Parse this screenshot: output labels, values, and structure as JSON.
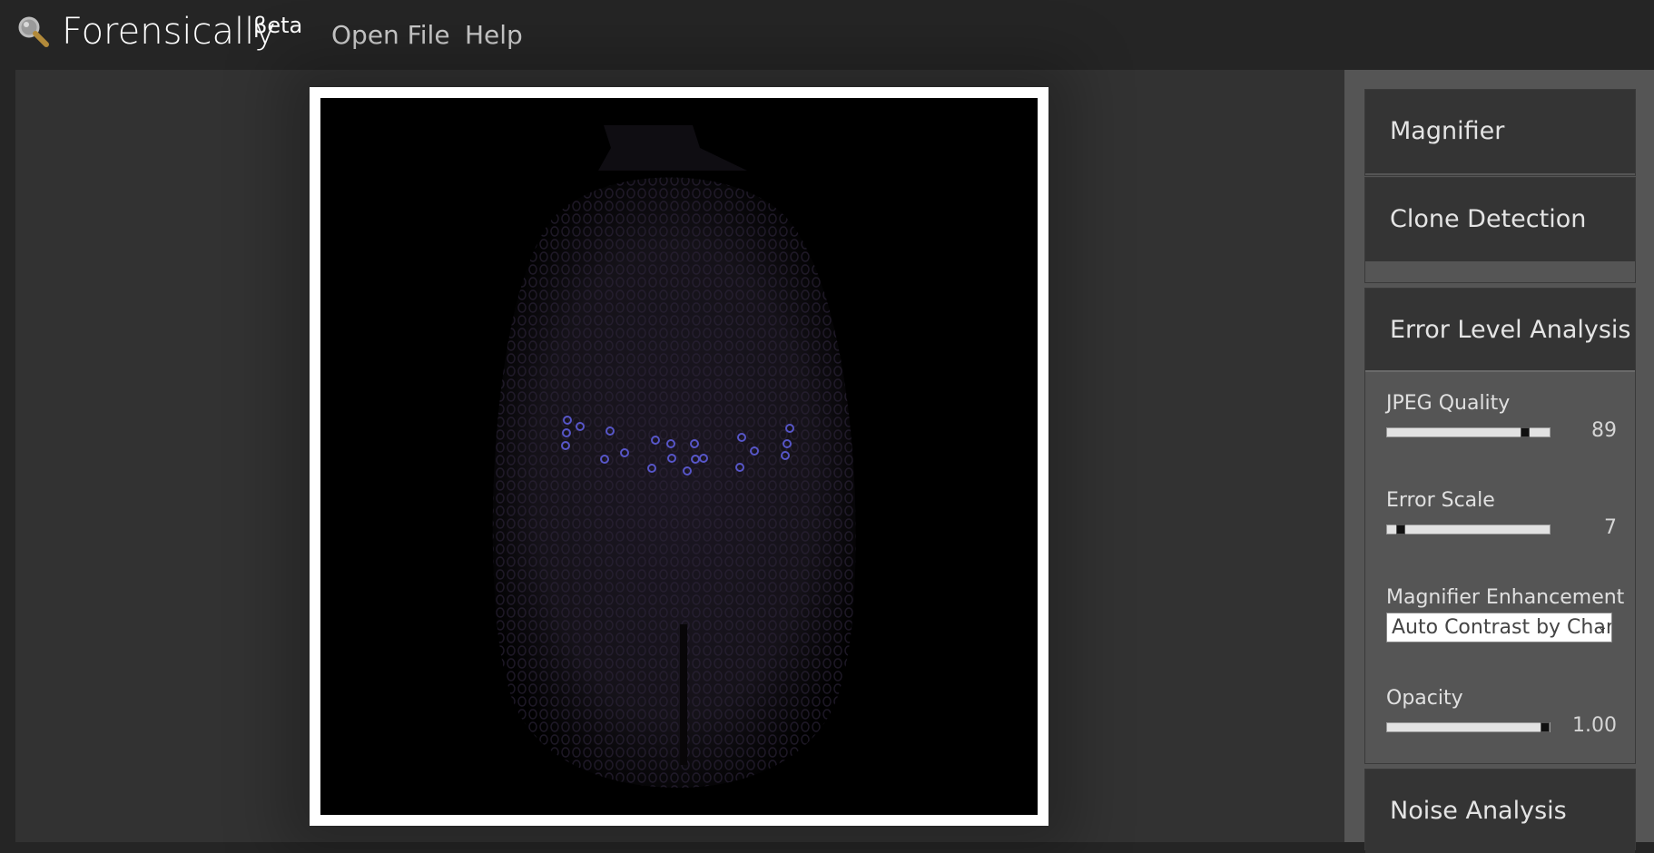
{
  "app": {
    "title": "Forensically",
    "beta": "βeta",
    "logo_icon": "magnifier-icon"
  },
  "nav": [
    {
      "label": "Open File"
    },
    {
      "label": "Help"
    }
  ],
  "sidebar": {
    "panels": {
      "magnifier": {
        "title": "Magnifier"
      },
      "clone": {
        "title": "Clone Detection"
      },
      "ela": {
        "title": "Error Level Analysis",
        "jpeg_quality": {
          "label": "JPEG Quality",
          "value": "89",
          "fraction": 0.87
        },
        "error_scale": {
          "label": "Error Scale",
          "value": "7",
          "fraction": 0.06
        },
        "enhancement": {
          "label": "Magnifier Enhancement",
          "selected": "Auto Contrast by Char"
        },
        "opacity": {
          "label": "Opacity",
          "value": "1.00",
          "fraction": 1.0
        }
      },
      "noise": {
        "title": "Noise Analysis"
      }
    }
  },
  "colors": {
    "background": "#252525",
    "workspace": "#323232",
    "sidebar": "#555555",
    "panel_header": "#343434",
    "ela_dots": "#6b6bff"
  }
}
